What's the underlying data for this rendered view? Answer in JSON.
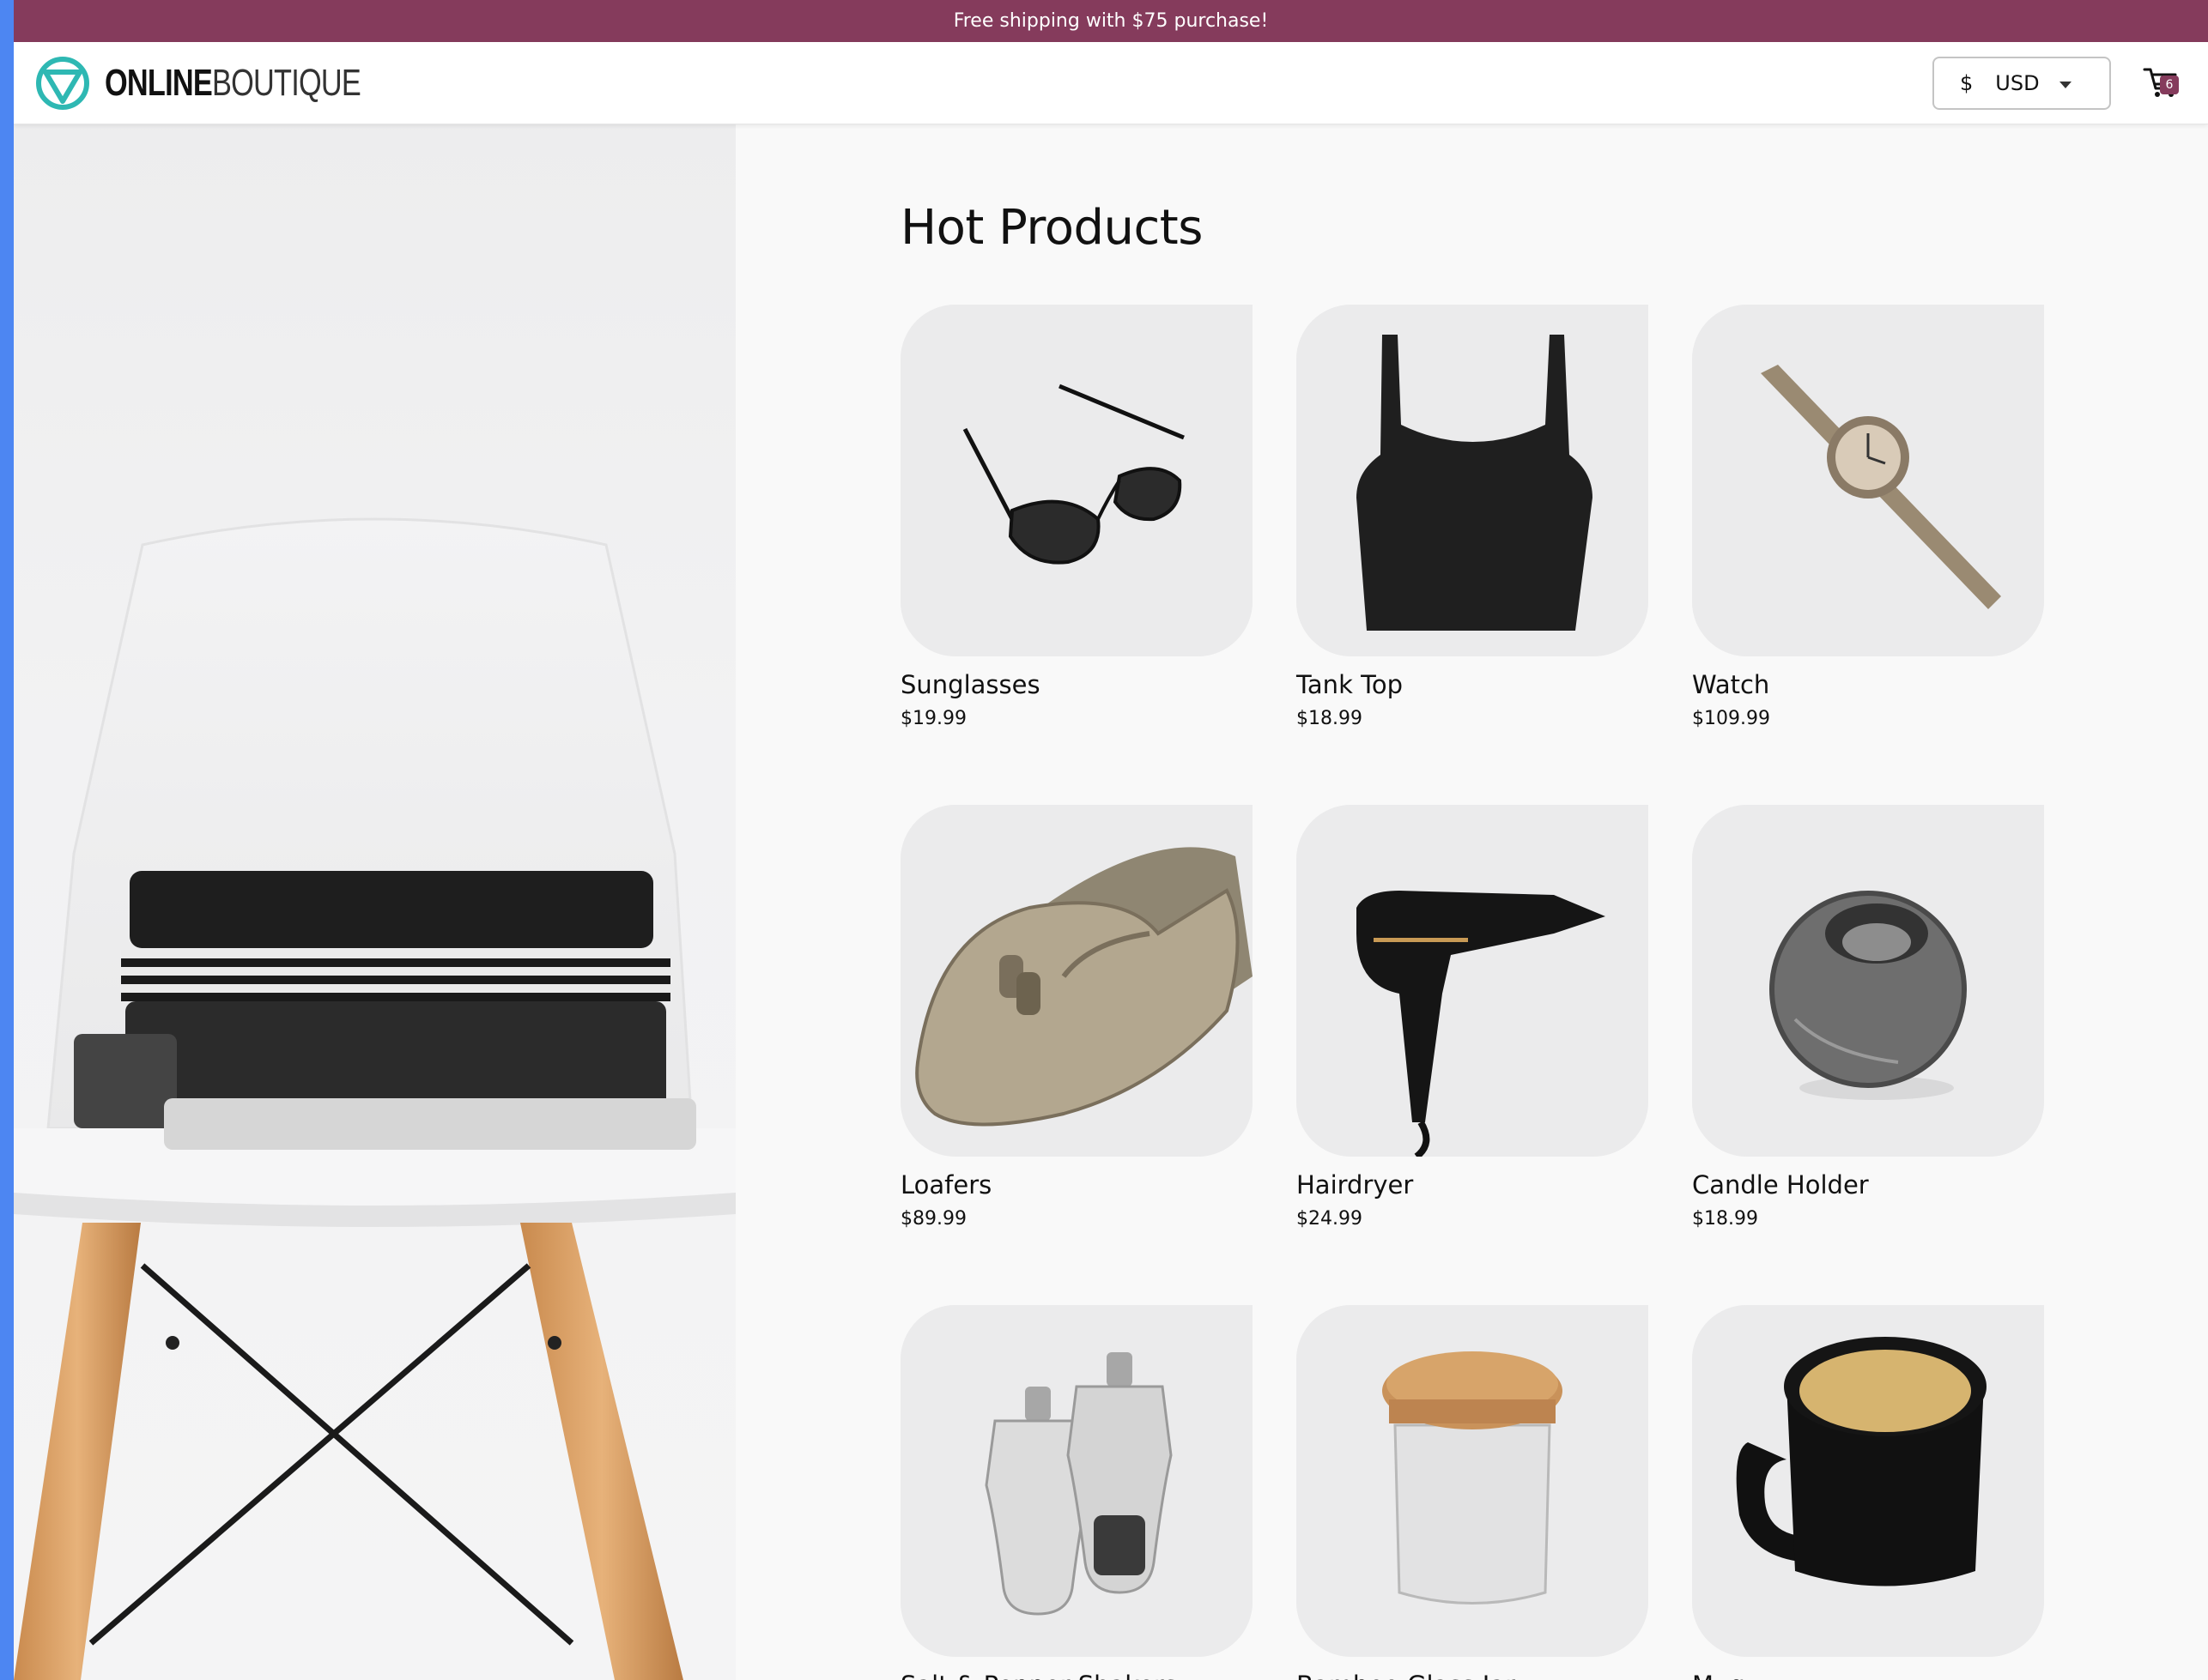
{
  "promo": {
    "text": "Free shipping with $75 purchase!"
  },
  "header": {
    "logo_strong": "ONLINE",
    "logo_light": "BOUTIQUE",
    "currency": {
      "symbol": "$",
      "code": "USD"
    },
    "cart_count": "6"
  },
  "colors": {
    "brand": "#853b5c",
    "accent": "#2eb8b3"
  },
  "main": {
    "title": "Hot Products",
    "products": [
      {
        "name": "Sunglasses",
        "price": "$19.99",
        "icon": "sunglasses-image"
      },
      {
        "name": "Tank Top",
        "price": "$18.99",
        "icon": "tank-top-image"
      },
      {
        "name": "Watch",
        "price": "$109.99",
        "icon": "watch-image"
      },
      {
        "name": "Loafers",
        "price": "$89.99",
        "icon": "loafers-image"
      },
      {
        "name": "Hairdryer",
        "price": "$24.99",
        "icon": "hairdryer-image"
      },
      {
        "name": "Candle Holder",
        "price": "$18.99",
        "icon": "candle-holder-image"
      },
      {
        "name": "Salt & Pepper Shakers",
        "price": "",
        "icon": "salt-pepper-image"
      },
      {
        "name": "Bamboo Glass Jar",
        "price": "",
        "icon": "bamboo-jar-image"
      },
      {
        "name": "Mug",
        "price": "",
        "icon": "mug-image"
      }
    ]
  }
}
